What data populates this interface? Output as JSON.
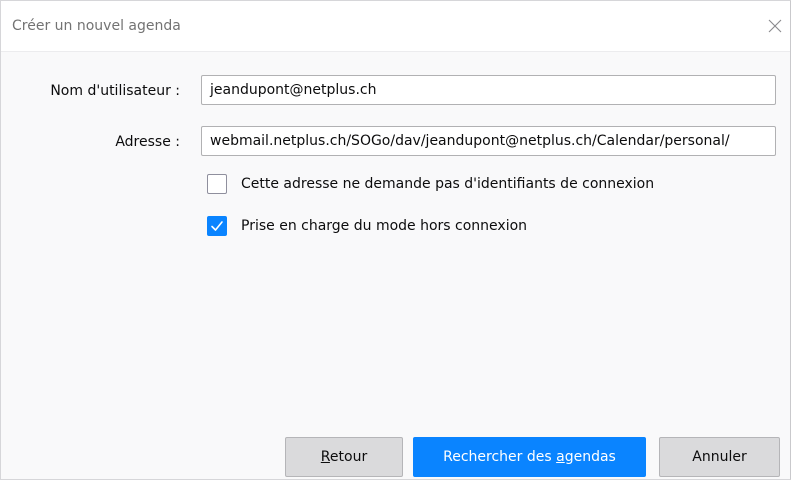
{
  "dialog": {
    "title": "Créer un nouvel agenda"
  },
  "form": {
    "username_label": "Nom d'utilisateur :",
    "username_value": "jeandupont@netplus.ch",
    "address_label": "Adresse :",
    "address_value": "webmail.netplus.ch/SOGo/dav/jeandupont@netplus.ch/Calendar/personal/"
  },
  "options": [
    {
      "label": "Cette adresse ne demande pas d'identifiants de connexion",
      "checked": false
    },
    {
      "label": "Prise en charge du mode hors connexion",
      "checked": true
    }
  ],
  "buttons": {
    "back": {
      "pre": "",
      "accel": "R",
      "post": "etour"
    },
    "search": {
      "pre": "Rechercher des ",
      "accel": "a",
      "post": "gendas"
    },
    "cancel": {
      "label": "Annuler"
    }
  },
  "colors": {
    "accent": "#0a84ff"
  }
}
